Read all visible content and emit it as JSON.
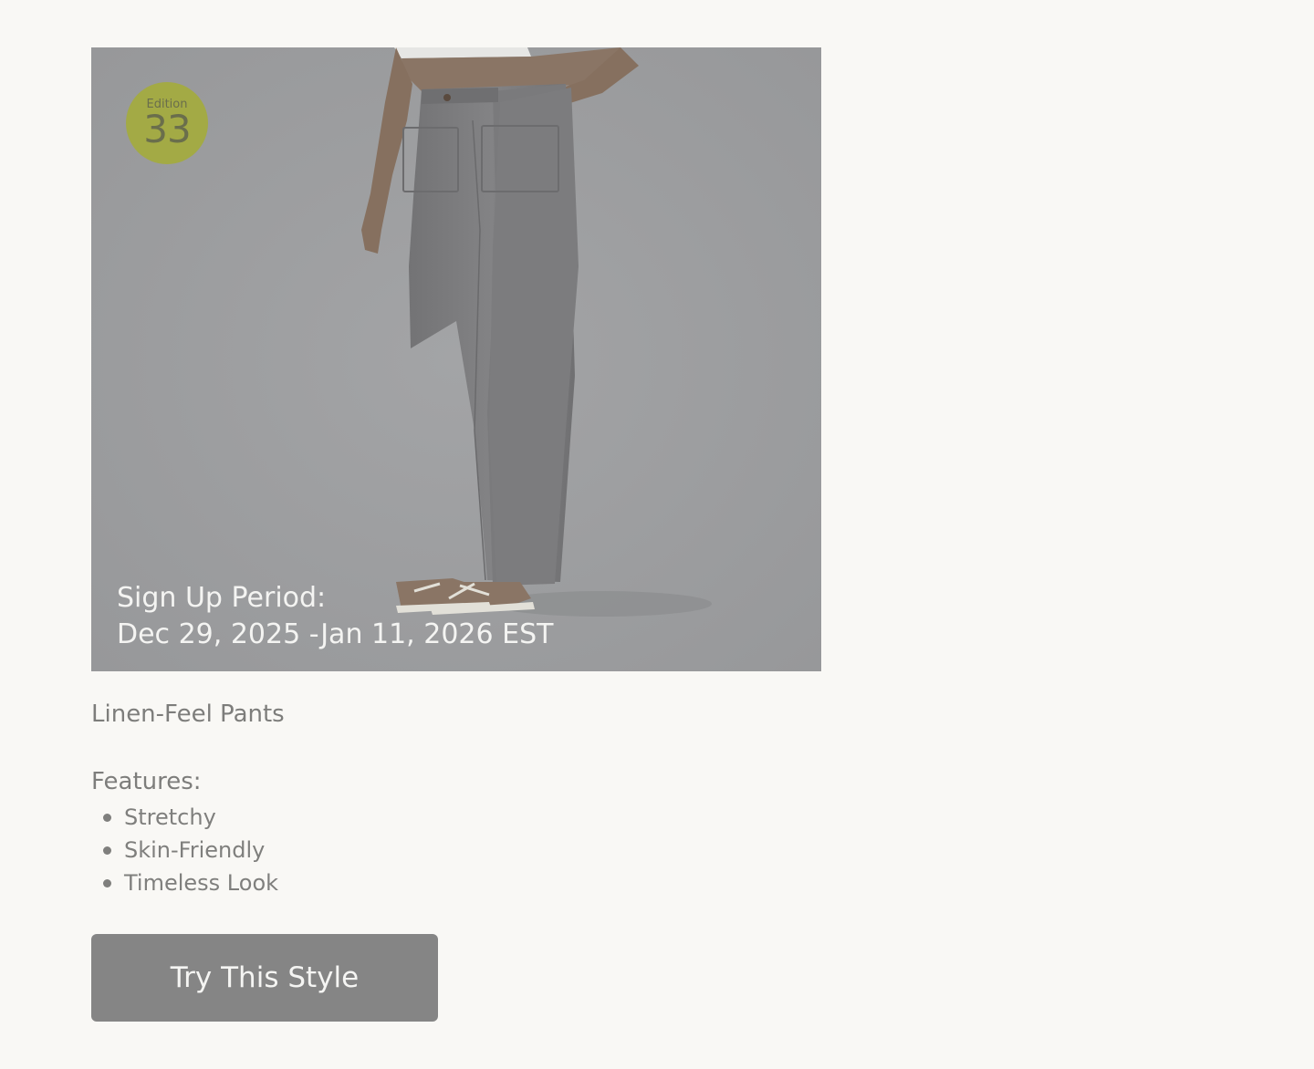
{
  "hero": {
    "image_alt": "woman wearing grey wide-leg linen-feel pants and strappy sandals",
    "badge": {
      "label": "Edition",
      "number": "33",
      "color": "#a3aa45"
    },
    "signup_label": "Sign Up Period:",
    "signup_dates": "Dec 29, 2025 -Jan 11, 2026 EST"
  },
  "product": {
    "name": "Linen-Feel Pants",
    "features_title": "Features:",
    "features": [
      "Stretchy",
      "Skin-Friendly",
      "Timeless Look"
    ]
  },
  "cta": {
    "label": "Try This Style"
  },
  "colors": {
    "page_background": "#f9f8f5",
    "overlay": "#9a9b9d",
    "button": "#858585"
  }
}
